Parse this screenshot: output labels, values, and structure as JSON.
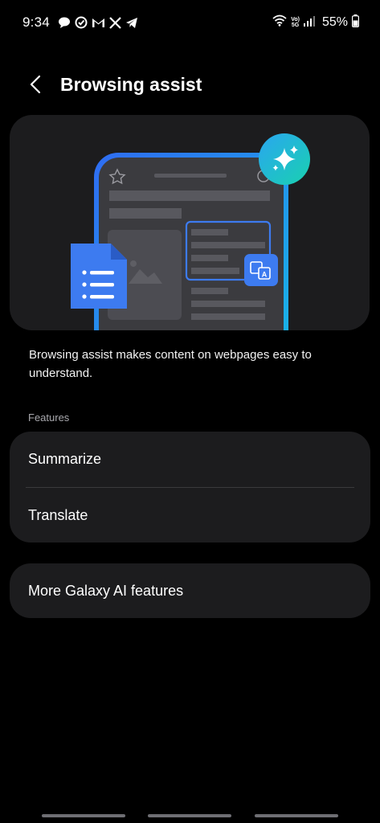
{
  "status_bar": {
    "time": "9:34",
    "notification_icons": [
      "chat-bubble-icon",
      "check-circle-icon",
      "gmail-icon",
      "x-icon",
      "telegram-icon"
    ],
    "volte_top": "Vo)",
    "volte_bottom": "5G",
    "battery_percent": "55%",
    "battery_level": 0.55
  },
  "header": {
    "title": "Browsing assist"
  },
  "description": "Browsing assist makes content on webpages easy to understand.",
  "features": {
    "label": "Features",
    "items": [
      {
        "label": "Summarize"
      },
      {
        "label": "Translate"
      }
    ]
  },
  "more": {
    "label": "More Galaxy AI features"
  },
  "colors": {
    "background": "#000000",
    "card": "#1c1c1e",
    "accent_blue": "#3d7bf0",
    "sparkle_teal": "#1ec6c0"
  }
}
